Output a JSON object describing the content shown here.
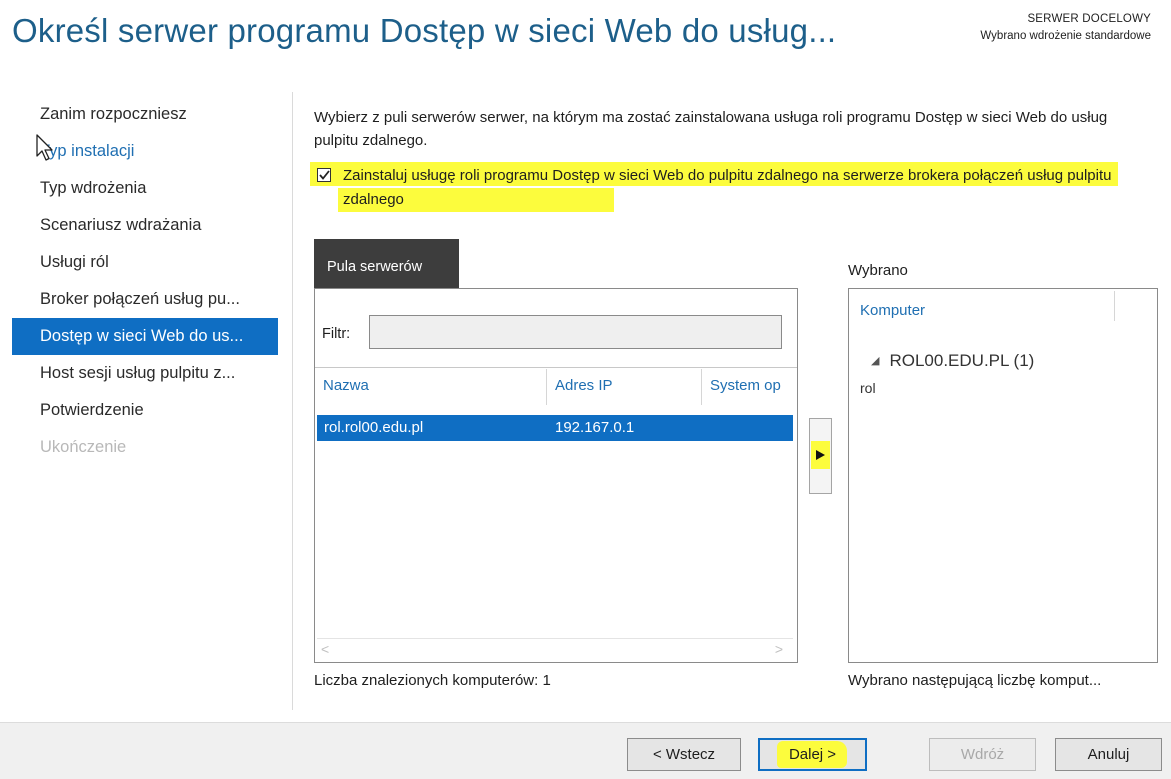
{
  "header": {
    "title": "Określ serwer programu Dostęp w sieci Web do usług...",
    "target_label": "SERWER DOCELOWY",
    "target_value": "Wybrano wdrożenie standardowe"
  },
  "nav": {
    "items": [
      {
        "label": "Zanim rozpoczniesz",
        "state": "normal"
      },
      {
        "label": "Typ instalacji",
        "state": "link"
      },
      {
        "label": "Typ wdrożenia",
        "state": "normal"
      },
      {
        "label": "Scenariusz wdrażania",
        "state": "normal"
      },
      {
        "label": "Usługi ról",
        "state": "normal"
      },
      {
        "label": "Broker połączeń usług pu...",
        "state": "normal"
      },
      {
        "label": "Dostęp w sieci Web do us...",
        "state": "active"
      },
      {
        "label": "Host sesji usług pulpitu z...",
        "state": "normal"
      },
      {
        "label": "Potwierdzenie",
        "state": "normal"
      },
      {
        "label": "Ukończenie",
        "state": "disabled"
      }
    ]
  },
  "content": {
    "description": "Wybierz z puli serwerów serwer, na którym ma zostać zainstalowana usługa roli programu Dostęp w sieci Web do usług pulpitu zdalnego.",
    "checkbox_label": "Zainstaluj usługę roli programu Dostęp w sieci Web do pulpitu zdalnego na serwerze brokera połączeń usług pulpitu zdalnego",
    "checkbox_checked": true
  },
  "pool": {
    "tab_label": "Pula serwerów",
    "filter_label": "Filtr:",
    "filter_value": "",
    "columns": [
      "Nazwa",
      "Adres IP",
      "System op"
    ],
    "rows": [
      {
        "name": "rol.rol00.edu.pl",
        "ip": "192.167.0.1",
        "os": "",
        "selected": true
      }
    ],
    "count_text": "Liczba znalezionych komputerów: 1"
  },
  "selected": {
    "label": "Wybrano",
    "column": "Komputer",
    "group": "ROL00.EDU.PL (1)",
    "item": "rol",
    "count_text": "Wybrano następującą liczbę komput..."
  },
  "footer": {
    "back": "< Wstecz",
    "next": "Dalej >",
    "deploy": "Wdróż",
    "cancel": "Anuluj"
  },
  "colors": {
    "accent": "#0f6ec3",
    "title": "#1d5f8a",
    "link": "#1f6fb2",
    "highlight": "#fcfc3d"
  },
  "icons": {
    "cursor": "mouse-pointer-icon",
    "add": "arrow-right-icon",
    "check": "checkmark-icon",
    "expand": "collapse-triangle-icon"
  }
}
